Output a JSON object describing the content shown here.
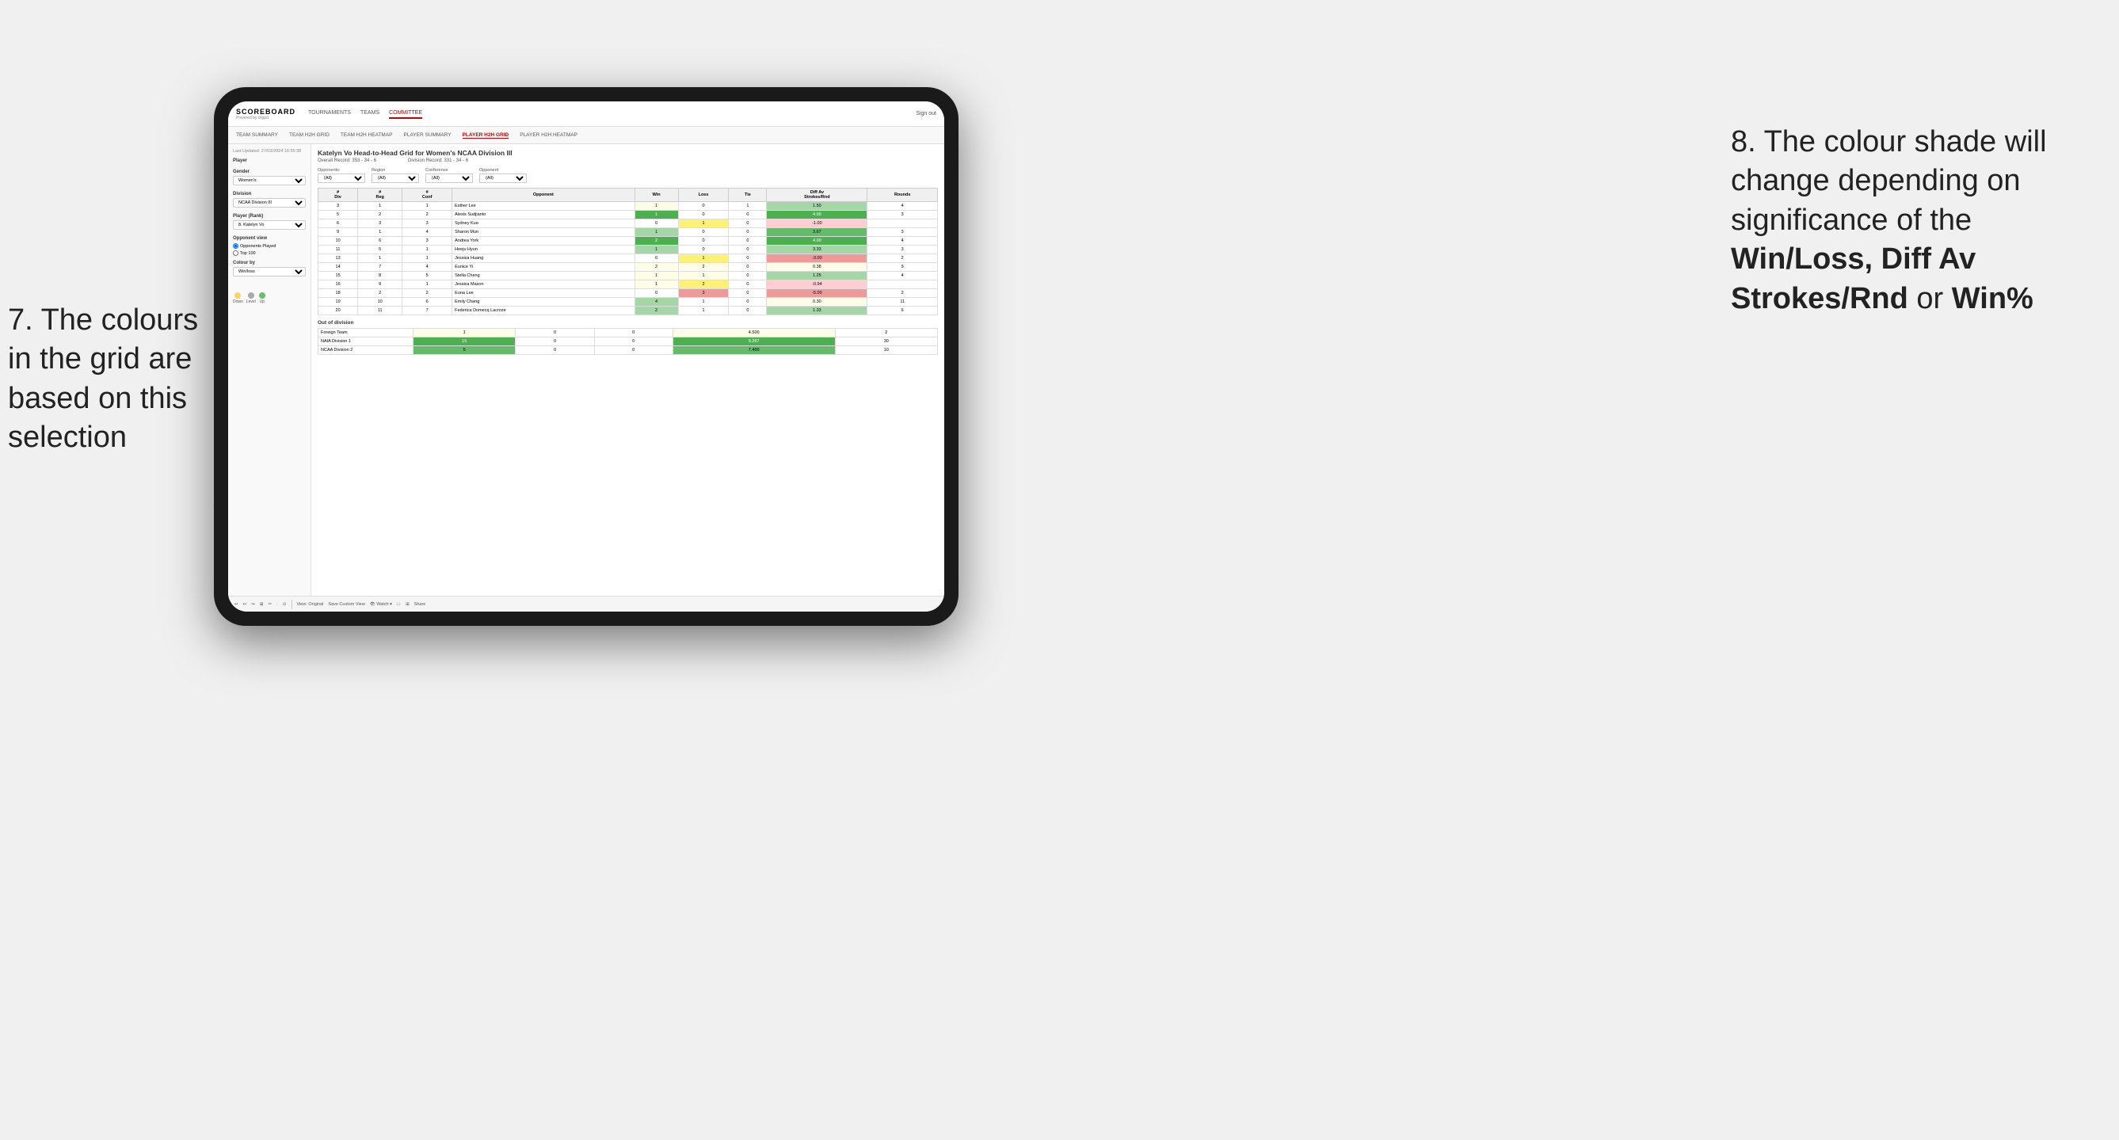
{
  "annotations": {
    "left_title": "7. The colours in the grid are based on this selection",
    "right_title": "8. The colour shade will change depending on significance of the Win/Loss, Diff Av Strokes/Rnd or Win%"
  },
  "nav": {
    "logo": "SCOREBOARD",
    "logo_sub": "Powered by clippd",
    "links": [
      "TOURNAMENTS",
      "TEAMS",
      "COMMITTEE"
    ],
    "sign_out": "Sign out"
  },
  "sub_nav": {
    "links": [
      "TEAM SUMMARY",
      "TEAM H2H GRID",
      "TEAM H2H HEATMAP",
      "PLAYER SUMMARY",
      "PLAYER H2H GRID",
      "PLAYER H2H HEATMAP"
    ],
    "active": "PLAYER H2H GRID"
  },
  "sidebar": {
    "timestamp": "Last Updated: 27/03/2024\n16:55:38",
    "player_label": "Player",
    "gender_label": "Gender",
    "gender_value": "Women's",
    "division_label": "Division",
    "division_value": "NCAA Division III",
    "player_rank_label": "Player (Rank)",
    "player_rank_value": "8. Katelyn Vo",
    "opponent_view_label": "Opponent view",
    "radio_opponents": "Opponents Played",
    "radio_top100": "Top 100",
    "colour_by_label": "Colour by",
    "colour_by_value": "Win/loss",
    "legend_down": "Down",
    "legend_level": "Level",
    "legend_up": "Up"
  },
  "data_panel": {
    "title": "Katelyn Vo Head-to-Head Grid for Women's NCAA Division III",
    "overall_record_label": "Overall Record:",
    "overall_record": "353 - 34 - 6",
    "division_record_label": "Division Record:",
    "division_record": "331 - 34 - 6",
    "filters": {
      "opponents_label": "Opponents:",
      "opponents_value": "(All)",
      "region_label": "Region",
      "region_value": "(All)",
      "conference_label": "Conference",
      "conference_value": "(All)",
      "opponent_label": "Opponent",
      "opponent_value": "(All)"
    },
    "table_headers": [
      "#\nDiv",
      "#\nReg",
      "#\nConf",
      "Opponent",
      "Win",
      "Loss",
      "Tie",
      "Diff Av\nStrokes/Rnd",
      "Rounds"
    ],
    "rows": [
      {
        "div": "3",
        "reg": "1",
        "conf": "1",
        "opponent": "Esther Lee",
        "win": "1",
        "loss": "0",
        "tie": "1",
        "diff": "1.50",
        "rounds": "4"
      },
      {
        "div": "5",
        "reg": "2",
        "conf": "2",
        "opponent": "Alexis Sudjianto",
        "win": "1",
        "loss": "0",
        "tie": "0",
        "diff": "4.00",
        "rounds": "3"
      },
      {
        "div": "6",
        "reg": "3",
        "conf": "3",
        "opponent": "Sydney Kuo",
        "win": "0",
        "loss": "1",
        "tie": "0",
        "diff": "-1.00",
        "rounds": ""
      },
      {
        "div": "9",
        "reg": "1",
        "conf": "4",
        "opponent": "Sharon Mun",
        "win": "1",
        "loss": "0",
        "tie": "0",
        "diff": "3.67",
        "rounds": "3"
      },
      {
        "div": "10",
        "reg": "6",
        "conf": "3",
        "opponent": "Andrea York",
        "win": "2",
        "loss": "0",
        "tie": "0",
        "diff": "4.00",
        "rounds": "4"
      },
      {
        "div": "13",
        "reg": "1",
        "conf": "1",
        "opponent": "Jessica Huang",
        "win": "0",
        "loss": "1",
        "tie": "0",
        "diff": "-3.00",
        "rounds": "2"
      },
      {
        "div": "11",
        "reg": "5",
        "conf": "1",
        "opponent": "Heeju Hyun",
        "win": "1",
        "loss": "0",
        "tie": "0",
        "diff": "3.33",
        "rounds": "3"
      },
      {
        "div": "14",
        "reg": "7",
        "conf": "4",
        "opponent": "Eunice Yi",
        "win": "2",
        "loss": "2",
        "tie": "0",
        "diff": "0.38",
        "rounds": "9"
      },
      {
        "div": "15",
        "reg": "8",
        "conf": "5",
        "opponent": "Stella Cheng",
        "win": "1",
        "loss": "1",
        "tie": "0",
        "diff": "1.25",
        "rounds": "4"
      },
      {
        "div": "16",
        "reg": "9",
        "conf": "1",
        "opponent": "Jessica Mason",
        "win": "1",
        "loss": "2",
        "tie": "0",
        "diff": "-0.94",
        "rounds": ""
      },
      {
        "div": "18",
        "reg": "2",
        "conf": "2",
        "opponent": "Euna Lee",
        "win": "0",
        "loss": "3",
        "tie": "0",
        "diff": "-5.00",
        "rounds": "2"
      },
      {
        "div": "19",
        "reg": "10",
        "conf": "6",
        "opponent": "Emily Chang",
        "win": "4",
        "loss": "1",
        "tie": "0",
        "diff": "0.30",
        "rounds": "11"
      },
      {
        "div": "20",
        "reg": "11",
        "conf": "7",
        "opponent": "Federica Domecq Lacroze",
        "win": "2",
        "loss": "1",
        "tie": "0",
        "diff": "1.33",
        "rounds": "6"
      }
    ],
    "out_of_division_label": "Out of division",
    "out_of_division_rows": [
      {
        "opponent": "Foreign Team",
        "win": "1",
        "loss": "0",
        "tie": "0",
        "diff": "4.500",
        "rounds": "2"
      },
      {
        "opponent": "NAIA Division 1",
        "win": "15",
        "loss": "0",
        "tie": "0",
        "diff": "9.267",
        "rounds": "30"
      },
      {
        "opponent": "NCAA Division 2",
        "win": "5",
        "loss": "0",
        "tie": "0",
        "diff": "7.400",
        "rounds": "10"
      }
    ]
  },
  "toolbar": {
    "buttons": [
      "↩",
      "↩",
      "↪",
      "⊞",
      "✂",
      "·",
      "⊙",
      "|",
      "View: Original",
      "Save Custom View",
      "👁 Watch ▾",
      "□·",
      "⊞",
      "Share"
    ]
  }
}
